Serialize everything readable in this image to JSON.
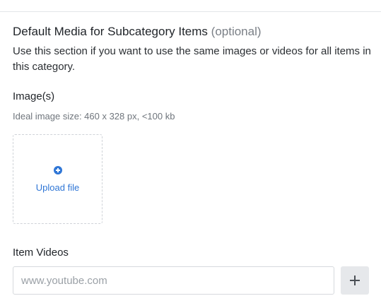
{
  "section": {
    "title": "Default Media for Subcategory Items",
    "title_optional": "(optional)",
    "description": "Use this section if you want to use the same images or videos for all items in this category."
  },
  "images": {
    "label": "Image(s)",
    "hint": "Ideal image size: 460 x 328 px, <100 kb",
    "upload_label": "Upload file",
    "upload_icon": "plus-circle-icon"
  },
  "videos": {
    "label": "Item Videos",
    "input_value": "",
    "input_placeholder": "www.youtube.com",
    "add_icon": "plus-icon"
  },
  "colors": {
    "accent": "#2f76d6",
    "muted_text": "#7a7f86",
    "border": "#d6d9dd",
    "button_bg": "#e6e8eb"
  }
}
